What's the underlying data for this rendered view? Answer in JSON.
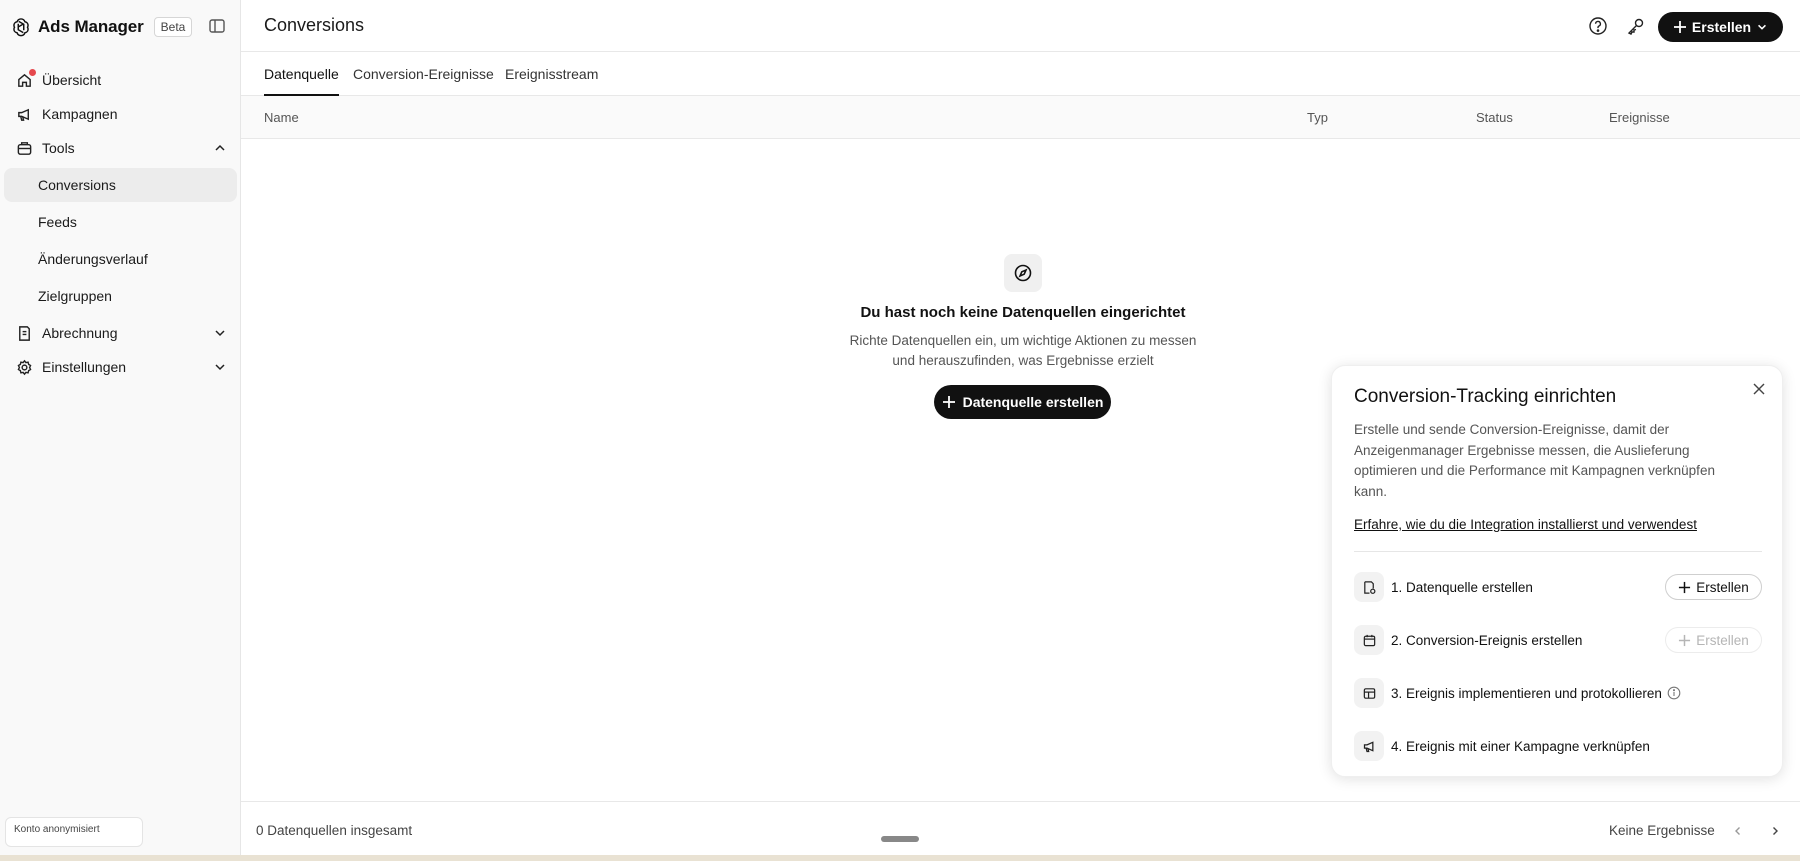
{
  "app": {
    "title": "Ads Manager",
    "badge": "Beta"
  },
  "sidebar": {
    "items": [
      {
        "label": "Übersicht",
        "icon": "home-icon",
        "has_notification": true
      },
      {
        "label": "Kampagnen",
        "icon": "megaphone-icon"
      },
      {
        "label": "Tools",
        "icon": "tools-icon",
        "expanded": true,
        "children": [
          {
            "label": "Conversions",
            "active": true
          },
          {
            "label": "Feeds"
          },
          {
            "label": "Änderungsverlauf"
          },
          {
            "label": "Zielgruppen"
          }
        ]
      },
      {
        "label": "Abrechnung",
        "icon": "billing-icon",
        "expanded": false
      },
      {
        "label": "Einstellungen",
        "icon": "settings-icon",
        "expanded": false
      }
    ],
    "account": "Konto anonymisiert"
  },
  "header": {
    "title": "Conversions",
    "create_label": "Erstellen"
  },
  "tabs": [
    {
      "label": "Datenquelle",
      "active": true
    },
    {
      "label": "Conversion-Ereignisse"
    },
    {
      "label": "Ereignisstream"
    }
  ],
  "table": {
    "columns": [
      "Name",
      "Typ",
      "Status",
      "Ereignisse"
    ]
  },
  "empty_state": {
    "title": "Du hast noch keine Datenquellen eingerichtet",
    "description": "Richte Datenquellen ein, um wichtige Aktionen zu messen und herauszufinden, was Ergebnisse erzielt",
    "button": "Datenquelle erstellen"
  },
  "panel": {
    "title": "Conversion-Tracking einrichten",
    "description": "Erstelle und sende Conversion-Ereignisse, damit der Anzeigenmanager Ergebnisse messen, die Auslieferung optimieren und die Performance mit Kampagnen verknüpfen kann.",
    "link": "Erfahre, wie du die Integration installierst und verwendest",
    "steps": [
      {
        "label": "1. Datenquelle erstellen",
        "button": "Erstellen",
        "enabled": true
      },
      {
        "label": "2. Conversion-Ereignis erstellen",
        "button": "Erstellen",
        "enabled": false
      },
      {
        "label": "3. Ereignis implementieren und protokollieren"
      },
      {
        "label": "4. Ereignis mit einer Kampagne verknüpfen"
      }
    ]
  },
  "footer": {
    "count": "0 Datenquellen insgesamt",
    "no_results": "Keine Ergebnisse"
  },
  "colors": {
    "primary": "#111111",
    "notification": "#e5484d",
    "sidebar_bg": "#f9f9f9",
    "active_item_bg": "#ececec"
  }
}
